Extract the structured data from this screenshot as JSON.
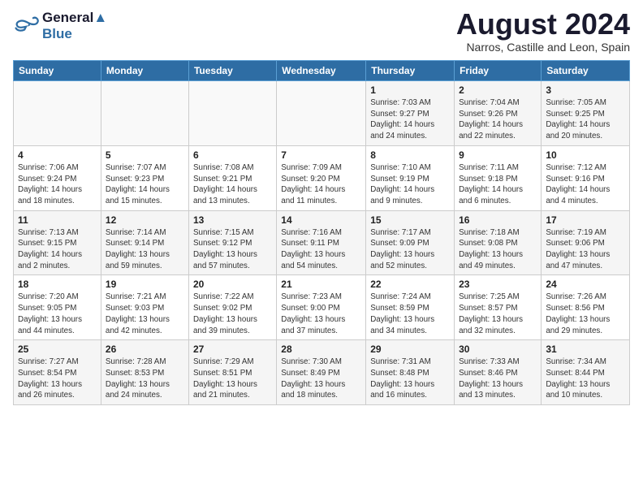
{
  "logo": {
    "line1": "General",
    "line2": "Blue"
  },
  "title": "August 2024",
  "location": "Narros, Castille and Leon, Spain",
  "headers": [
    "Sunday",
    "Monday",
    "Tuesday",
    "Wednesday",
    "Thursday",
    "Friday",
    "Saturday"
  ],
  "weeks": [
    [
      {
        "day": "",
        "info": ""
      },
      {
        "day": "",
        "info": ""
      },
      {
        "day": "",
        "info": ""
      },
      {
        "day": "",
        "info": ""
      },
      {
        "day": "1",
        "info": "Sunrise: 7:03 AM\nSunset: 9:27 PM\nDaylight: 14 hours\nand 24 minutes."
      },
      {
        "day": "2",
        "info": "Sunrise: 7:04 AM\nSunset: 9:26 PM\nDaylight: 14 hours\nand 22 minutes."
      },
      {
        "day": "3",
        "info": "Sunrise: 7:05 AM\nSunset: 9:25 PM\nDaylight: 14 hours\nand 20 minutes."
      }
    ],
    [
      {
        "day": "4",
        "info": "Sunrise: 7:06 AM\nSunset: 9:24 PM\nDaylight: 14 hours\nand 18 minutes."
      },
      {
        "day": "5",
        "info": "Sunrise: 7:07 AM\nSunset: 9:23 PM\nDaylight: 14 hours\nand 15 minutes."
      },
      {
        "day": "6",
        "info": "Sunrise: 7:08 AM\nSunset: 9:21 PM\nDaylight: 14 hours\nand 13 minutes."
      },
      {
        "day": "7",
        "info": "Sunrise: 7:09 AM\nSunset: 9:20 PM\nDaylight: 14 hours\nand 11 minutes."
      },
      {
        "day": "8",
        "info": "Sunrise: 7:10 AM\nSunset: 9:19 PM\nDaylight: 14 hours\nand 9 minutes."
      },
      {
        "day": "9",
        "info": "Sunrise: 7:11 AM\nSunset: 9:18 PM\nDaylight: 14 hours\nand 6 minutes."
      },
      {
        "day": "10",
        "info": "Sunrise: 7:12 AM\nSunset: 9:16 PM\nDaylight: 14 hours\nand 4 minutes."
      }
    ],
    [
      {
        "day": "11",
        "info": "Sunrise: 7:13 AM\nSunset: 9:15 PM\nDaylight: 14 hours\nand 2 minutes."
      },
      {
        "day": "12",
        "info": "Sunrise: 7:14 AM\nSunset: 9:14 PM\nDaylight: 13 hours\nand 59 minutes."
      },
      {
        "day": "13",
        "info": "Sunrise: 7:15 AM\nSunset: 9:12 PM\nDaylight: 13 hours\nand 57 minutes."
      },
      {
        "day": "14",
        "info": "Sunrise: 7:16 AM\nSunset: 9:11 PM\nDaylight: 13 hours\nand 54 minutes."
      },
      {
        "day": "15",
        "info": "Sunrise: 7:17 AM\nSunset: 9:09 PM\nDaylight: 13 hours\nand 52 minutes."
      },
      {
        "day": "16",
        "info": "Sunrise: 7:18 AM\nSunset: 9:08 PM\nDaylight: 13 hours\nand 49 minutes."
      },
      {
        "day": "17",
        "info": "Sunrise: 7:19 AM\nSunset: 9:06 PM\nDaylight: 13 hours\nand 47 minutes."
      }
    ],
    [
      {
        "day": "18",
        "info": "Sunrise: 7:20 AM\nSunset: 9:05 PM\nDaylight: 13 hours\nand 44 minutes."
      },
      {
        "day": "19",
        "info": "Sunrise: 7:21 AM\nSunset: 9:03 PM\nDaylight: 13 hours\nand 42 minutes."
      },
      {
        "day": "20",
        "info": "Sunrise: 7:22 AM\nSunset: 9:02 PM\nDaylight: 13 hours\nand 39 minutes."
      },
      {
        "day": "21",
        "info": "Sunrise: 7:23 AM\nSunset: 9:00 PM\nDaylight: 13 hours\nand 37 minutes."
      },
      {
        "day": "22",
        "info": "Sunrise: 7:24 AM\nSunset: 8:59 PM\nDaylight: 13 hours\nand 34 minutes."
      },
      {
        "day": "23",
        "info": "Sunrise: 7:25 AM\nSunset: 8:57 PM\nDaylight: 13 hours\nand 32 minutes."
      },
      {
        "day": "24",
        "info": "Sunrise: 7:26 AM\nSunset: 8:56 PM\nDaylight: 13 hours\nand 29 minutes."
      }
    ],
    [
      {
        "day": "25",
        "info": "Sunrise: 7:27 AM\nSunset: 8:54 PM\nDaylight: 13 hours\nand 26 minutes."
      },
      {
        "day": "26",
        "info": "Sunrise: 7:28 AM\nSunset: 8:53 PM\nDaylight: 13 hours\nand 24 minutes."
      },
      {
        "day": "27",
        "info": "Sunrise: 7:29 AM\nSunset: 8:51 PM\nDaylight: 13 hours\nand 21 minutes."
      },
      {
        "day": "28",
        "info": "Sunrise: 7:30 AM\nSunset: 8:49 PM\nDaylight: 13 hours\nand 18 minutes."
      },
      {
        "day": "29",
        "info": "Sunrise: 7:31 AM\nSunset: 8:48 PM\nDaylight: 13 hours\nand 16 minutes."
      },
      {
        "day": "30",
        "info": "Sunrise: 7:33 AM\nSunset: 8:46 PM\nDaylight: 13 hours\nand 13 minutes."
      },
      {
        "day": "31",
        "info": "Sunrise: 7:34 AM\nSunset: 8:44 PM\nDaylight: 13 hours\nand 10 minutes."
      }
    ]
  ]
}
